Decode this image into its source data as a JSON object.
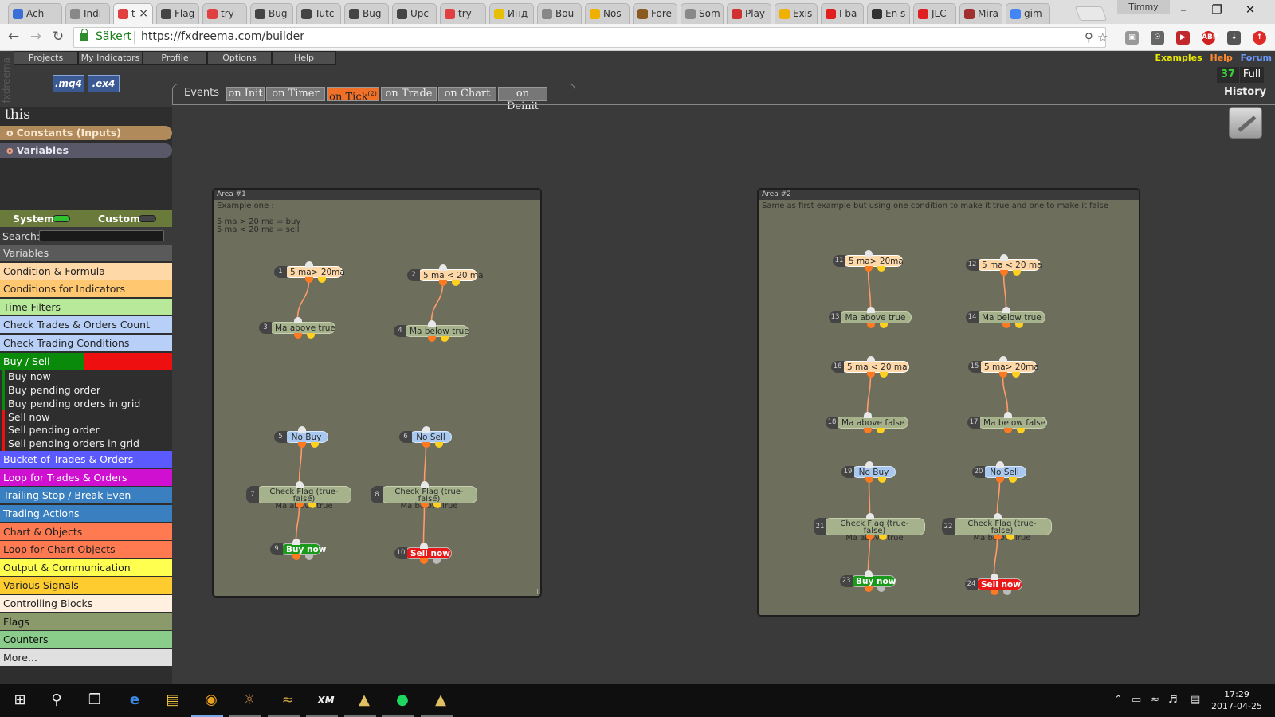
{
  "browser": {
    "tabs": [
      {
        "label": "Ach",
        "fav": "#3b6fd8"
      },
      {
        "label": "Indi",
        "fav": "#888"
      },
      {
        "label": "t",
        "fav": "#e04040",
        "active": true
      },
      {
        "label": "Flag",
        "fav": "#444"
      },
      {
        "label": "try",
        "fav": "#e04040"
      },
      {
        "label": "Bug",
        "fav": "#444"
      },
      {
        "label": "Tutc",
        "fav": "#444"
      },
      {
        "label": "Bug",
        "fav": "#444"
      },
      {
        "label": "Upc",
        "fav": "#444"
      },
      {
        "label": "try",
        "fav": "#e04040"
      },
      {
        "label": "Инд",
        "fav": "#e6c000"
      },
      {
        "label": "Bou",
        "fav": "#888"
      },
      {
        "label": "Nos",
        "fav": "#f0b000"
      },
      {
        "label": "Fore",
        "fav": "#8a5a20"
      },
      {
        "label": "Som",
        "fav": "#888"
      },
      {
        "label": "Play",
        "fav": "#d03030"
      },
      {
        "label": "Exis",
        "fav": "#f0b000"
      },
      {
        "label": "I ba",
        "fav": "#e02020"
      },
      {
        "label": "En s",
        "fav": "#333"
      },
      {
        "label": "JLC",
        "fav": "#e02020"
      },
      {
        "label": "Mira",
        "fav": "#a03030"
      },
      {
        "label": "gim",
        "fav": "#4285f4"
      }
    ],
    "profile_name": "Timmy",
    "secure_label": "Säkert",
    "url": "https://fxdreema.com/builder"
  },
  "app": {
    "brand": "fxdreema",
    "menu": [
      "Projects",
      "My Indicators",
      "Profile",
      "Options",
      "Help"
    ],
    "file_buttons": [
      ".mq4",
      ".ex4"
    ],
    "top_links": {
      "examples": "Examples",
      "help": "Help",
      "forum": "Forum"
    },
    "counter": "37",
    "full_label": "Full",
    "history_label": "History",
    "events_label": "Events",
    "event_tabs": [
      {
        "label": "on Init"
      },
      {
        "label": "on Timer"
      },
      {
        "label": "on Tick",
        "badge": "(2)",
        "active": true
      },
      {
        "label": "on Trade"
      },
      {
        "label": "on Chart"
      },
      {
        "label": "on Deinit"
      }
    ]
  },
  "sidebar": {
    "this_label": "this",
    "constants": "Constants (Inputs)",
    "variables": "Variables",
    "system": "System",
    "custom": "Custom",
    "search_label": "Search:",
    "categories": [
      {
        "label": "Variables",
        "bg": "#5a5a5a",
        "fg": "#ddd"
      },
      {
        "label": "Condition & Formula",
        "bg": "#ffd8a8",
        "fg": "#222"
      },
      {
        "label": "Conditions for Indicators",
        "bg": "#ffc870",
        "fg": "#222"
      },
      {
        "label": "Time Filters",
        "bg": "#b8e89a",
        "fg": "#222"
      },
      {
        "label": "Check Trades & Orders Count",
        "bg": "#b8d0f8",
        "fg": "#222"
      },
      {
        "label": "Check Trading Conditions",
        "bg": "#b8d0f8",
        "fg": "#222"
      },
      {
        "label": "Buy / Sell",
        "bg": "#0a8a0a",
        "fg": "#fff"
      }
    ],
    "buy_sell_items": [
      "Buy now",
      "Buy pending order",
      "Buy pending orders in grid",
      "Sell now",
      "Sell pending order",
      "Sell pending orders in grid"
    ],
    "categories_after": [
      {
        "label": "Bucket of Trades & Orders",
        "bg": "#5a5aff",
        "fg": "#fff"
      },
      {
        "label": "Loop for Trades & Orders",
        "bg": "#d010d0",
        "fg": "#fff"
      },
      {
        "label": "Trailing Stop / Break Even",
        "bg": "#3a80c0",
        "fg": "#fff"
      },
      {
        "label": "Trading Actions",
        "bg": "#3a80c0",
        "fg": "#fff"
      },
      {
        "label": "Chart & Objects",
        "bg": "#ff7a50",
        "fg": "#222"
      },
      {
        "label": "Loop for Chart Objects",
        "bg": "#ff7a50",
        "fg": "#222"
      },
      {
        "label": "Output & Communication",
        "bg": "#ffff50",
        "fg": "#222"
      },
      {
        "label": "Various Signals",
        "bg": "#ffcc30",
        "fg": "#222"
      },
      {
        "label": "Controlling Blocks",
        "bg": "#fff0e0",
        "fg": "#222"
      },
      {
        "label": "Flags",
        "bg": "#8a9a6a",
        "fg": "#111"
      },
      {
        "label": "Counters",
        "bg": "#8acc8a",
        "fg": "#111"
      },
      {
        "label": "More...",
        "bg": "#e0e0e0",
        "fg": "#222"
      }
    ]
  },
  "areas": [
    {
      "title": "Area #1",
      "description": "Example one :\n\n5 ma > 20 ma = buy\n5 ma < 20 ma = sell",
      "blocks": [
        {
          "num": "1",
          "text": "5 ma> 20ma",
          "kind": "cond"
        },
        {
          "num": "2",
          "text": "5 ma < 20 ma",
          "kind": "cond"
        },
        {
          "num": "3",
          "text": "Ma above true",
          "kind": "check"
        },
        {
          "num": "4",
          "text": "Ma below true",
          "kind": "check"
        },
        {
          "num": "5",
          "text": "No Buy",
          "kind": "trade"
        },
        {
          "num": "6",
          "text": "No Sell",
          "kind": "trade"
        },
        {
          "num": "7",
          "text": "Check Flag (true-false)\nMa above true",
          "kind": "check"
        },
        {
          "num": "8",
          "text": "Check Flag (true-false)\nMa below True",
          "kind": "check"
        },
        {
          "num": "9",
          "text": "Buy now",
          "kind": "buy"
        },
        {
          "num": "10",
          "text": "Sell now",
          "kind": "sell"
        }
      ]
    },
    {
      "title": "Area #2",
      "description": "Same as first example but using one condition to make it true and one to make it false",
      "blocks": [
        {
          "num": "11",
          "text": "5 ma> 20ma",
          "kind": "cond"
        },
        {
          "num": "12",
          "text": "5 ma < 20 ma",
          "kind": "cond"
        },
        {
          "num": "13",
          "text": "Ma above true",
          "kind": "check"
        },
        {
          "num": "14",
          "text": "Ma below true",
          "kind": "check"
        },
        {
          "num": "16",
          "text": "5 ma < 20 ma",
          "kind": "cond"
        },
        {
          "num": "15",
          "text": "5 ma> 20ma",
          "kind": "cond"
        },
        {
          "num": "18",
          "text": "Ma above  false",
          "kind": "check"
        },
        {
          "num": "17",
          "text": "Ma below false",
          "kind": "check"
        },
        {
          "num": "19",
          "text": "No Buy",
          "kind": "trade"
        },
        {
          "num": "20",
          "text": "No Sell",
          "kind": "trade"
        },
        {
          "num": "21",
          "text": "Check Flag (true-false)\nMa above true",
          "kind": "check"
        },
        {
          "num": "22",
          "text": "Check Flag (true-false)\nMa below True",
          "kind": "check"
        },
        {
          "num": "23",
          "text": "Buy now",
          "kind": "buy"
        },
        {
          "num": "24",
          "text": "Sell now",
          "kind": "sell"
        }
      ]
    }
  ],
  "taskbar": {
    "time": "17:29",
    "date": "2017-04-25"
  }
}
